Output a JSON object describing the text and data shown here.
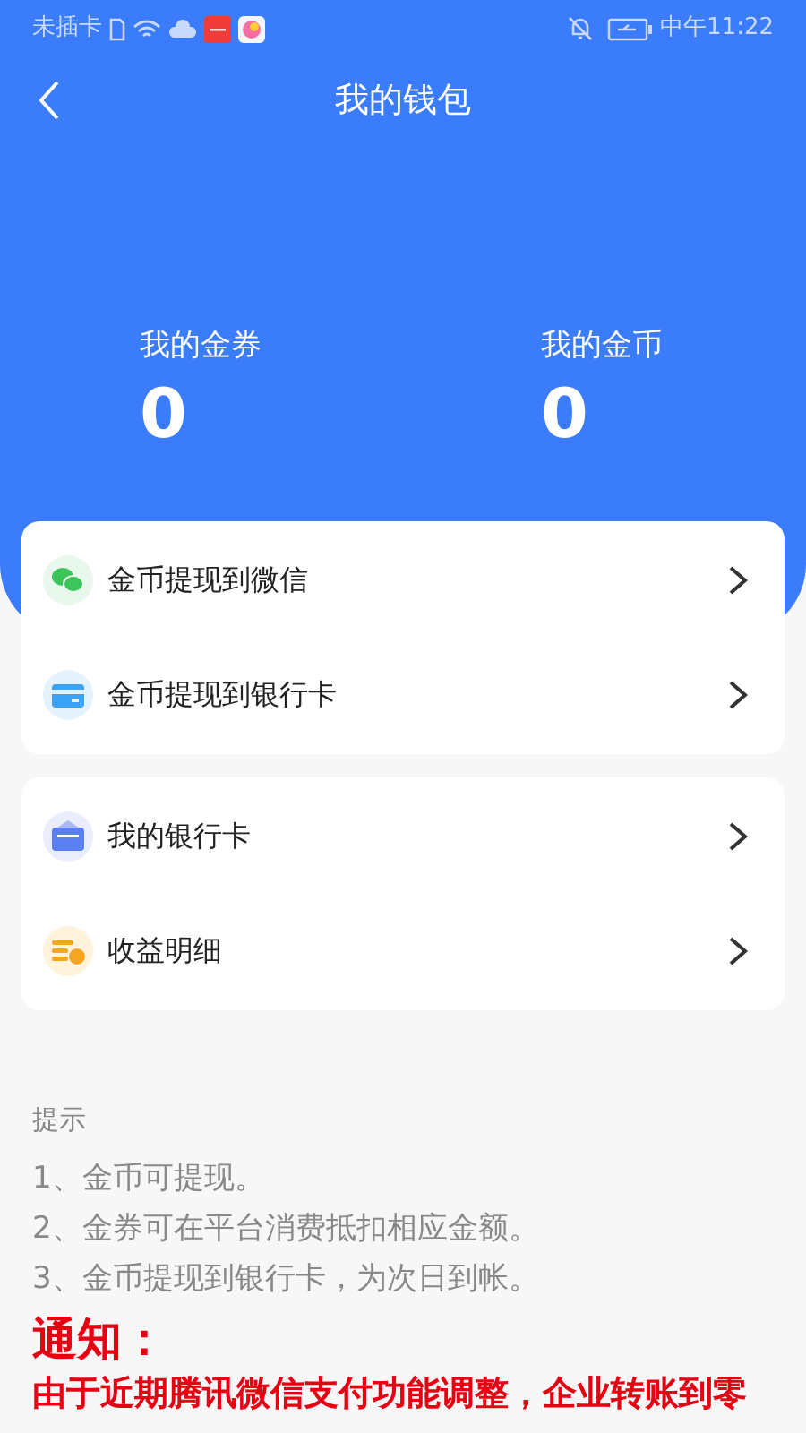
{
  "status_bar": {
    "carrier": "未插卡",
    "time": "中午11:22"
  },
  "header": {
    "title": "我的钱包"
  },
  "stats": [
    {
      "label": "我的金券",
      "value": "0"
    },
    {
      "label": "我的金币",
      "value": "0"
    }
  ],
  "menu_groups": [
    [
      {
        "kind": "wechat",
        "label": "金币提现到微信"
      },
      {
        "kind": "card",
        "label": "金币提现到银行卡"
      }
    ],
    [
      {
        "kind": "wallet",
        "label": "我的银行卡"
      },
      {
        "kind": "coins",
        "label": "收益明细"
      }
    ]
  ],
  "tips": {
    "title": "提示",
    "lines": [
      "1、金币可提现。",
      "2、金券可在平台消费抵扣相应金额。",
      "3、金币提现到银行卡，为次日到帐。"
    ]
  },
  "notice": {
    "title": "通知：",
    "text": "由于近期腾讯微信支付功能调整，企业转账到零"
  }
}
